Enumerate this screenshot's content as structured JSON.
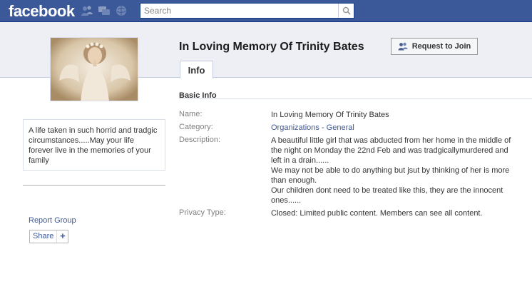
{
  "topbar": {
    "logo": "facebook",
    "search": {
      "placeholder": "Search",
      "value": ""
    },
    "jewels": [
      "friend-requests-icon",
      "messages-icon",
      "notifications-icon"
    ]
  },
  "colors": {
    "topbar": "#3b5998",
    "header_band": "#edeff4",
    "link": "#3b5998",
    "label": "#808080"
  },
  "group": {
    "title": "In Loving Memory Of Trinity Bates",
    "join_button": "Request to Join",
    "tab_info": "Info",
    "about": "A life taken in such horrid and tradgic circumstances.....May your life forever live in the memories of your family",
    "report_link": "Report Group",
    "share_label": "Share",
    "share_plus": "+"
  },
  "basic_info": {
    "heading": "Basic Info",
    "rows": [
      {
        "label": "Name:",
        "value": "In Loving Memory Of Trinity Bates"
      },
      {
        "label": "Category:",
        "value": "Organizations - General",
        "link_parts": [
          "Organizations",
          " - ",
          "General"
        ]
      },
      {
        "label": "Description:",
        "value_lines": [
          "A beautiful little girl that was abducted from her home in the middle of the night on Monday the 22nd Feb and was tradgicallymurdered and left in a drain......",
          "We may not be able to do anything but jsut by thinking of her is more than enough.",
          "Our children dont need to be treated like this, they are the innocent ones......"
        ]
      },
      {
        "label": "Privacy Type:",
        "value": "Closed: Limited public content. Members can see all content."
      }
    ]
  }
}
